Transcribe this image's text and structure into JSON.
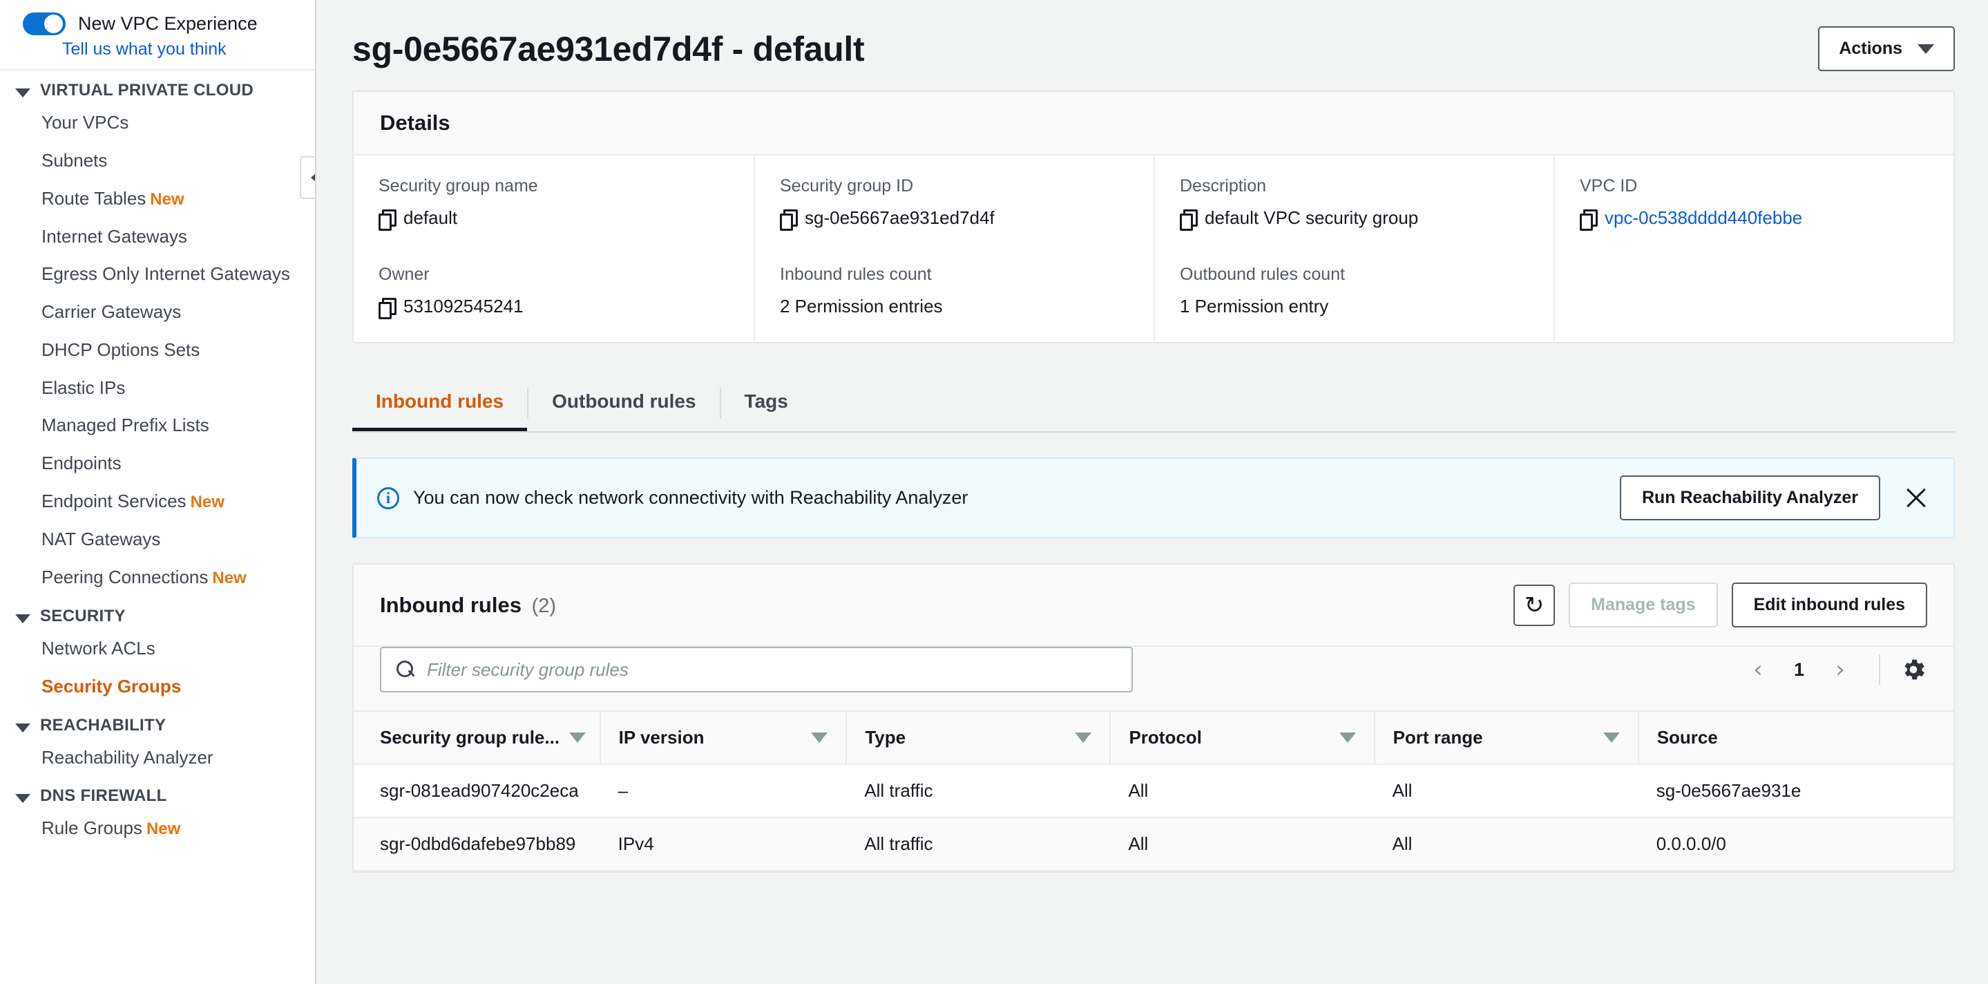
{
  "sidebar": {
    "experience_toggle": {
      "label": "New VPC Experience",
      "enabled": true,
      "feedback_link": "Tell us what you think"
    },
    "sections": [
      {
        "label": "VIRTUAL PRIVATE CLOUD",
        "items": [
          {
            "label": "Your VPCs",
            "badge": "",
            "active": false
          },
          {
            "label": "Subnets",
            "badge": "",
            "active": false
          },
          {
            "label": "Route Tables",
            "badge": "New",
            "active": false
          },
          {
            "label": "Internet Gateways",
            "badge": "",
            "active": false
          },
          {
            "label": "Egress Only Internet Gateways",
            "badge": "",
            "active": false
          },
          {
            "label": "Carrier Gateways",
            "badge": "",
            "active": false
          },
          {
            "label": "DHCP Options Sets",
            "badge": "",
            "active": false
          },
          {
            "label": "Elastic IPs",
            "badge": "",
            "active": false
          },
          {
            "label": "Managed Prefix Lists",
            "badge": "",
            "active": false
          },
          {
            "label": "Endpoints",
            "badge": "",
            "active": false
          },
          {
            "label": "Endpoint Services",
            "badge": "New",
            "active": false
          },
          {
            "label": "NAT Gateways",
            "badge": "",
            "active": false
          },
          {
            "label": "Peering Connections",
            "badge": "New",
            "active": false
          }
        ]
      },
      {
        "label": "SECURITY",
        "items": [
          {
            "label": "Network ACLs",
            "badge": "",
            "active": false
          },
          {
            "label": "Security Groups",
            "badge": "",
            "active": true
          }
        ]
      },
      {
        "label": "REACHABILITY",
        "items": [
          {
            "label": "Reachability Analyzer",
            "badge": "",
            "active": false
          }
        ]
      },
      {
        "label": "DNS FIREWALL",
        "items": [
          {
            "label": "Rule Groups",
            "badge": "New",
            "active": false
          }
        ]
      }
    ]
  },
  "header": {
    "title": "sg-0e5667ae931ed7d4f - default",
    "actions_label": "Actions"
  },
  "details": {
    "title": "Details",
    "fields": [
      {
        "label": "Security group name",
        "value": "default",
        "copy": true,
        "link": false
      },
      {
        "label": "Security group ID",
        "value": "sg-0e5667ae931ed7d4f",
        "copy": true,
        "link": false
      },
      {
        "label": "Description",
        "value": "default VPC security group",
        "copy": true,
        "link": false
      },
      {
        "label": "VPC ID",
        "value": "vpc-0c538dddd440febbe",
        "copy": true,
        "link": true
      },
      {
        "label": "Owner",
        "value": "531092545241",
        "copy": true,
        "link": false
      },
      {
        "label": "Inbound rules count",
        "value": "2 Permission entries",
        "copy": false,
        "link": false
      },
      {
        "label": "Outbound rules count",
        "value": "1 Permission entry",
        "copy": false,
        "link": false
      },
      {
        "label": "",
        "value": "",
        "copy": false,
        "link": false
      }
    ]
  },
  "tabs": [
    {
      "label": "Inbound rules",
      "active": true
    },
    {
      "label": "Outbound rules",
      "active": false
    },
    {
      "label": "Tags",
      "active": false
    }
  ],
  "banner": {
    "text": "You can now check network connectivity with Reachability Analyzer",
    "button_label": "Run Reachability Analyzer",
    "accent_color": "#0972d3"
  },
  "rules_panel": {
    "title": "Inbound rules",
    "count": "(2)",
    "manage_tags_label": "Manage tags",
    "edit_label": "Edit inbound rules",
    "search_placeholder": "Filter security group rules",
    "search_value": "",
    "page_number": "1",
    "columns": [
      {
        "label": "Security group rule...",
        "sortable": true
      },
      {
        "label": "IP version",
        "sortable": true
      },
      {
        "label": "Type",
        "sortable": true
      },
      {
        "label": "Protocol",
        "sortable": true
      },
      {
        "label": "Port range",
        "sortable": true
      },
      {
        "label": "Source",
        "sortable": false
      }
    ],
    "rows": [
      {
        "rule_id": "sgr-081ead907420c2eca",
        "ip_version": "–",
        "type": "All traffic",
        "protocol": "All",
        "port_range": "All",
        "source": "sg-0e5667ae931e"
      },
      {
        "rule_id": "sgr-0dbd6dafebe97bb89",
        "ip_version": "IPv4",
        "type": "All traffic",
        "protocol": "All",
        "port_range": "All",
        "source": "0.0.0.0/0"
      }
    ]
  }
}
